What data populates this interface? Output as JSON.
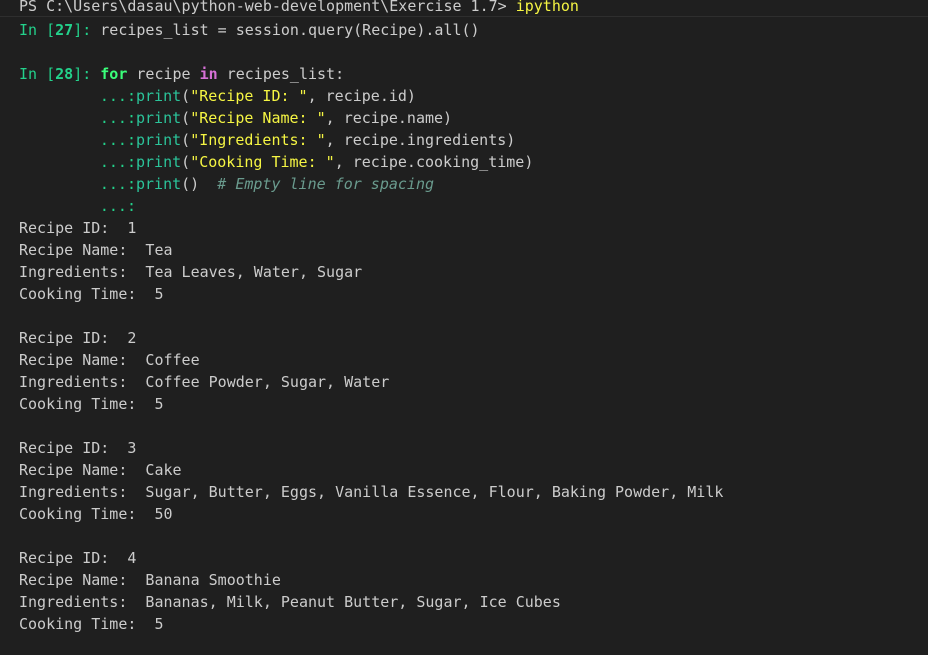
{
  "prompt": {
    "path": "PS C:\\Users\\dasau\\python-web-development\\Exercise 1.7> ",
    "command": "ipython"
  },
  "cell27": {
    "in_open": "In [",
    "num": "27",
    "in_close": "]: ",
    "code": "recipes_list = session.query(Recipe).all()"
  },
  "cell28": {
    "in_open": "In [",
    "num": "28",
    "in_close": "]: ",
    "kw_for": "for",
    "var": " recipe ",
    "kw_in": "in",
    "rest": " recipes_list:",
    "cont": "...:",
    "lines": [
      {
        "fn": "print",
        "open": "(",
        "str": "\"Recipe ID: \"",
        "rest": ", recipe.id)"
      },
      {
        "fn": "print",
        "open": "(",
        "str": "\"Recipe Name: \"",
        "rest": ", recipe.name)"
      },
      {
        "fn": "print",
        "open": "(",
        "str": "\"Ingredients: \"",
        "rest": ", recipe.ingredients)"
      },
      {
        "fn": "print",
        "open": "(",
        "str": "\"Cooking Time: \"",
        "rest": ", recipe.cooking_time)"
      }
    ],
    "last_print": "print",
    "last_parens": "()",
    "comment": "# Empty line for spacing"
  },
  "output": [
    {
      "id": "Recipe ID:  1",
      "name": "Recipe Name:  Tea",
      "ingredients": "Ingredients:  Tea Leaves, Water, Sugar",
      "time": "Cooking Time:  5"
    },
    {
      "id": "Recipe ID:  2",
      "name": "Recipe Name:  Coffee",
      "ingredients": "Ingredients:  Coffee Powder, Sugar, Water",
      "time": "Cooking Time:  5"
    },
    {
      "id": "Recipe ID:  3",
      "name": "Recipe Name:  Cake",
      "ingredients": "Ingredients:  Sugar, Butter, Eggs, Vanilla Essence, Flour, Baking Powder, Milk",
      "time": "Cooking Time:  50"
    },
    {
      "id": "Recipe ID:  4",
      "name": "Recipe Name:  Banana Smoothie",
      "ingredients": "Ingredients:  Bananas, Milk, Peanut Butter, Sugar, Ice Cubes",
      "time": "Cooking Time:  5"
    }
  ],
  "colors": {
    "background": "#1f1f1f",
    "text": "#cccccc",
    "prompt_green": "#23d18b",
    "string_yellow": "#f5f543",
    "keyword_in": "#d670d6",
    "comment": "#6a9b8e"
  }
}
